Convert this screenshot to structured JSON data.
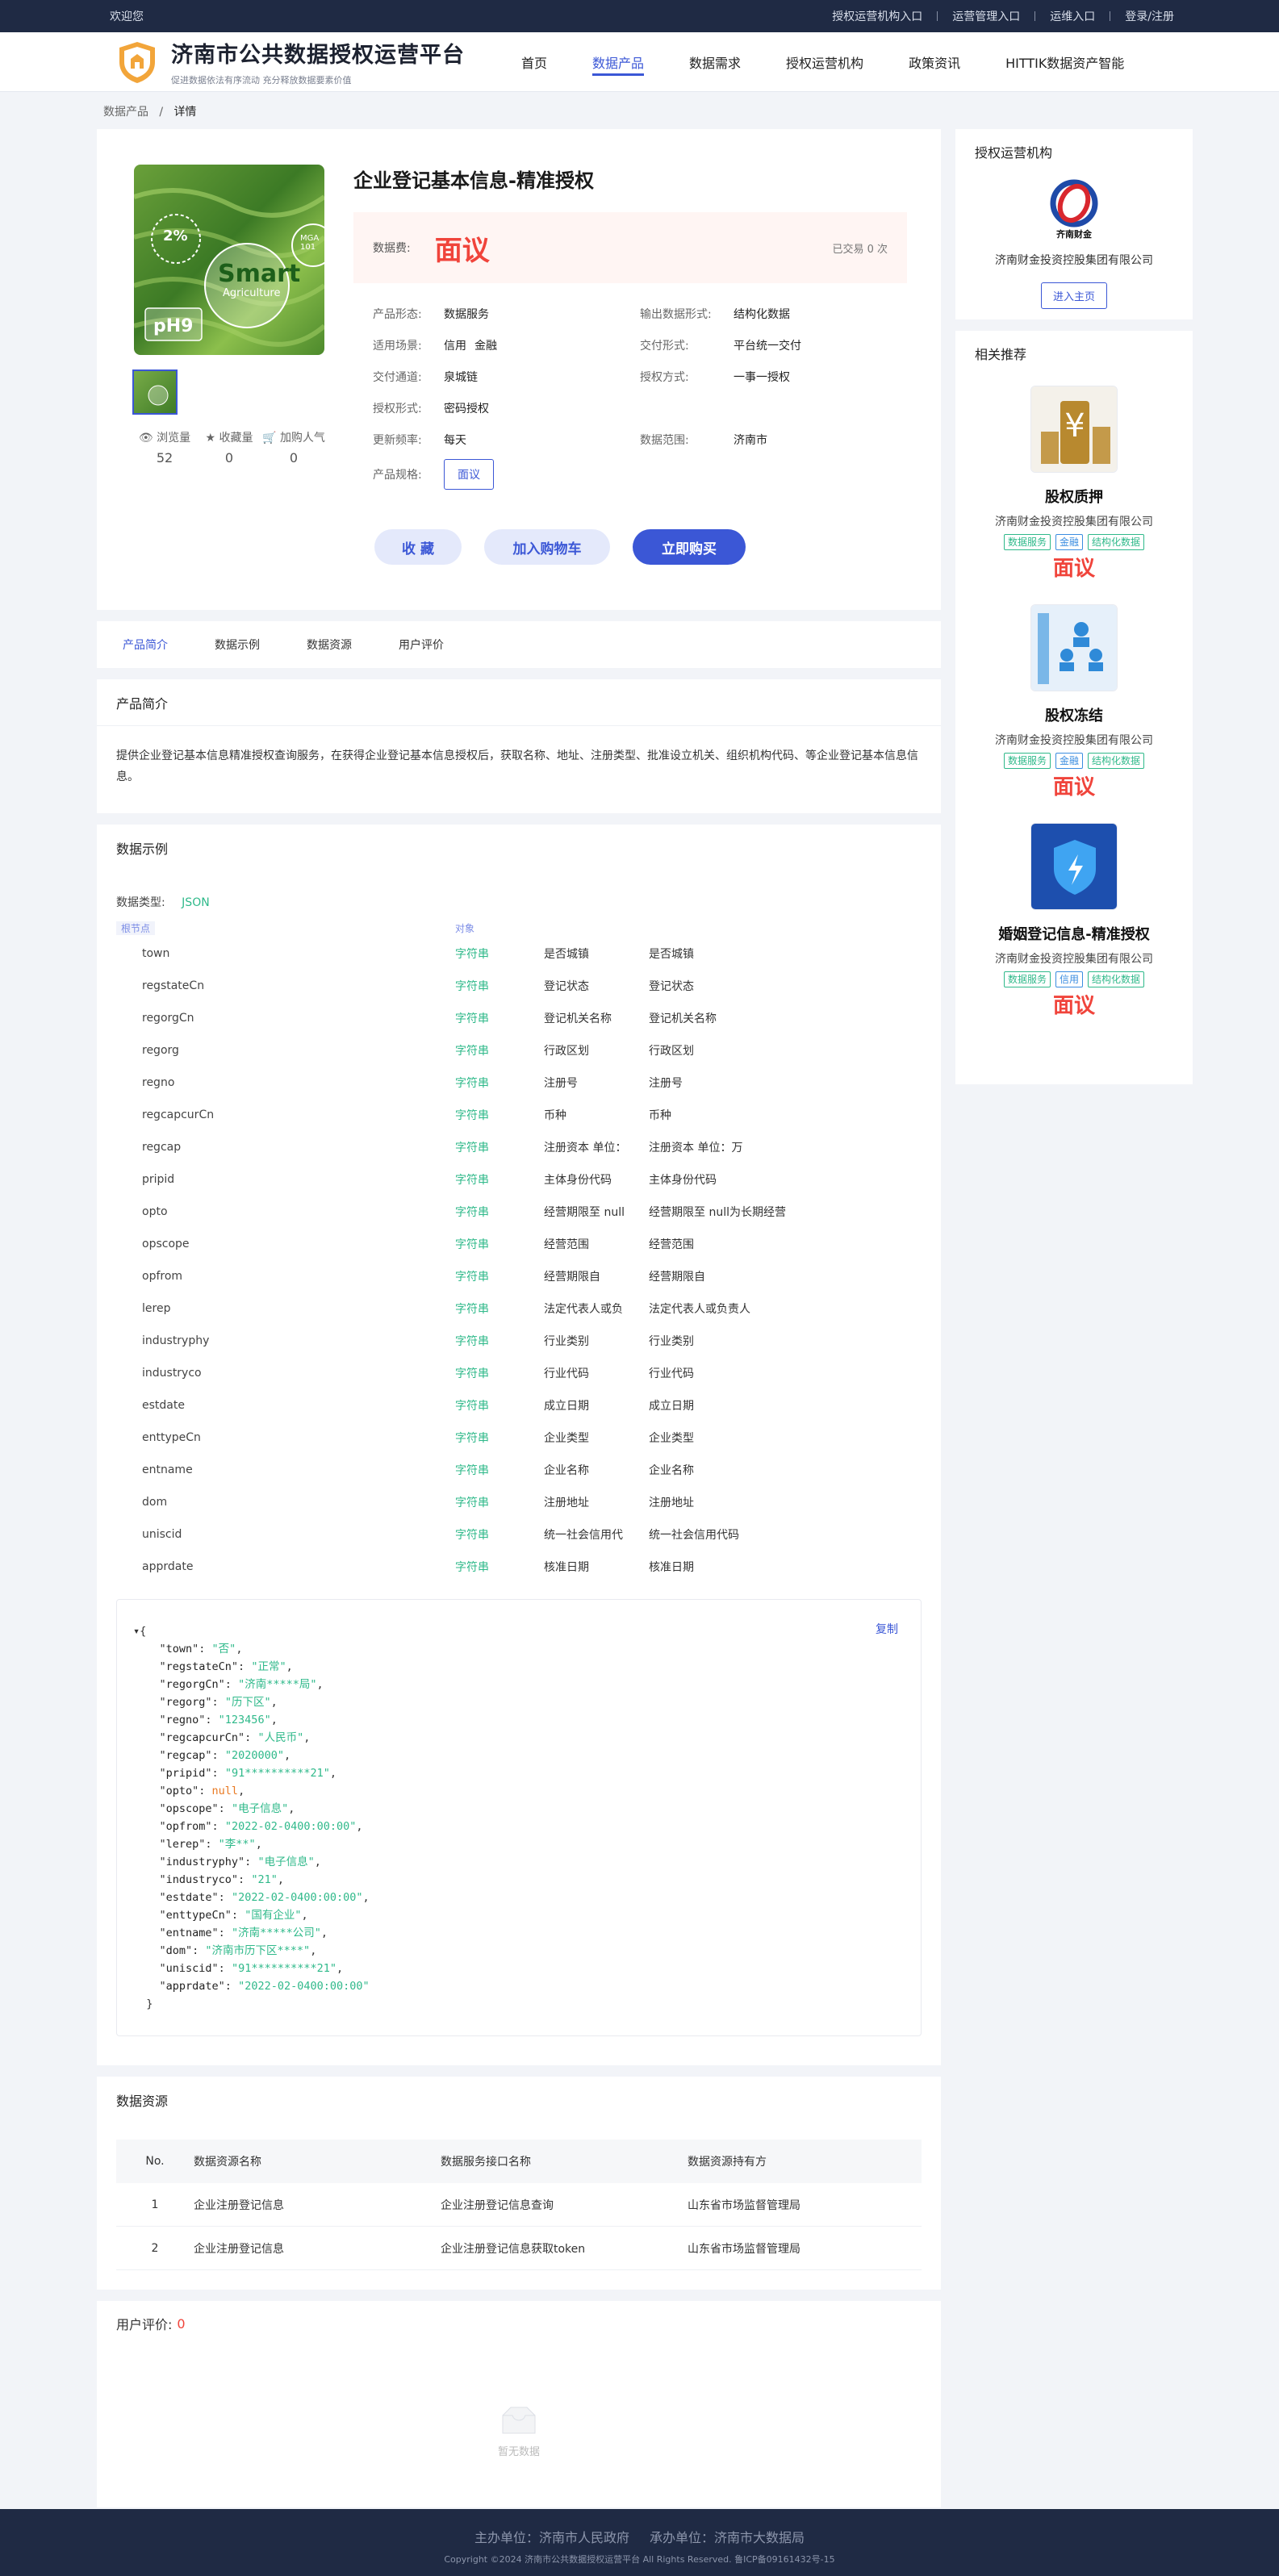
{
  "topbar": {
    "welcome": "欢迎您",
    "links": [
      "授权运营机构入口",
      "运营管理入口",
      "运维入口",
      "登录/注册"
    ]
  },
  "header": {
    "title": "济南市公共数据授权运营平台",
    "subtitle": "促进数据依法有序流动 充分释放数据要素价值",
    "nav": [
      "首页",
      "数据产品",
      "数据需求",
      "授权运营机构",
      "政策资讯",
      "HITTIK数据资产智能"
    ],
    "active_nav": "数据产品"
  },
  "breadcrumb": {
    "root": "数据产品",
    "current": "详情"
  },
  "product": {
    "title": "企业登记基本信息-精准授权",
    "price_label": "数据费:",
    "price": "面议",
    "sold": "已交易 0 次",
    "thumb_text": {
      "percent": "2%",
      "smart": "Smart",
      "agri": "Agriculture",
      "ph": "pH9",
      "mg": "MGA 101"
    },
    "stats": [
      {
        "icon": "eye-icon",
        "label": "浏览量",
        "value": "52"
      },
      {
        "icon": "star-icon",
        "label": "收藏量",
        "value": "0"
      },
      {
        "icon": "cart-icon",
        "label": "加购人气",
        "value": "0"
      }
    ],
    "attrs": [
      [
        {
          "k": "产品形态:",
          "v": [
            "数据服务"
          ]
        },
        {
          "k": "输出数据形式:",
          "v": [
            "结构化数据"
          ]
        }
      ],
      [
        {
          "k": "适用场景:",
          "v": [
            "信用",
            "金融"
          ]
        },
        {
          "k": "交付形式:",
          "v": [
            "平台统一交付"
          ]
        }
      ],
      [
        {
          "k": "交付通道:",
          "v": [
            "泉城链"
          ]
        },
        {
          "k": "授权方式:",
          "v": [
            "一事一授权"
          ]
        }
      ],
      [
        {
          "k": "授权形式:",
          "v": [
            "密码授权"
          ]
        },
        null
      ],
      [
        {
          "k": "更新频率:",
          "v": [
            "每天"
          ]
        },
        {
          "k": "数据范围:",
          "v": [
            "济南市"
          ]
        }
      ]
    ],
    "spec_label": "产品规格:",
    "spec_value": "面议",
    "buttons": {
      "fav": "收 藏",
      "cart": "加入购物车",
      "buy": "立即购买"
    }
  },
  "tabs": [
    "产品简介",
    "数据示例",
    "数据资源",
    "用户评价"
  ],
  "intro": {
    "title": "产品简介",
    "text": "提供企业登记基本信息精准授权查询服务，在获得企业登记基本信息授权后，获取名称、地址、注册类型、批准设立机关、组织机构代码、等企业登记基本信息信息。"
  },
  "example": {
    "title": "数据示例",
    "type_label": "数据类型:",
    "type_value": "JSON",
    "col_root": "根节点",
    "col_obj": "对象",
    "fields": [
      [
        "town",
        "字符串",
        "是否城镇",
        "是否城镇"
      ],
      [
        "regstateCn",
        "字符串",
        "登记状态",
        "登记状态"
      ],
      [
        "regorgCn",
        "字符串",
        "登记机关名称",
        "登记机关名称"
      ],
      [
        "regorg",
        "字符串",
        "行政区划",
        "行政区划"
      ],
      [
        "regno",
        "字符串",
        "注册号",
        "注册号"
      ],
      [
        "regcapcurCn",
        "字符串",
        "币种",
        "币种"
      ],
      [
        "regcap",
        "字符串",
        "注册资本 单位：",
        "注册资本 单位：万"
      ],
      [
        "pripid",
        "字符串",
        "主体身份代码",
        "主体身份代码"
      ],
      [
        "opto",
        "字符串",
        "经营期限至 null",
        "经营期限至 null为长期经营"
      ],
      [
        "opscope",
        "字符串",
        "经营范围",
        "经营范围"
      ],
      [
        "opfrom",
        "字符串",
        "经营期限自",
        "经营期限自"
      ],
      [
        "lerep",
        "字符串",
        "法定代表人或负",
        "法定代表人或负责人"
      ],
      [
        "industryphy",
        "字符串",
        "行业类别",
        "行业类别"
      ],
      [
        "industryco",
        "字符串",
        "行业代码",
        "行业代码"
      ],
      [
        "estdate",
        "字符串",
        "成立日期",
        "成立日期"
      ],
      [
        "enttypeCn",
        "字符串",
        "企业类型",
        "企业类型"
      ],
      [
        "entname",
        "字符串",
        "企业名称",
        "企业名称"
      ],
      [
        "dom",
        "字符串",
        "注册地址",
        "注册地址"
      ],
      [
        "uniscid",
        "字符串",
        "统一社会信用代",
        "统一社会信用代码"
      ],
      [
        "apprdate",
        "字符串",
        "核准日期",
        "核准日期"
      ]
    ],
    "copy_label": "复制",
    "json_lines": [
      [
        "town",
        "\"否\""
      ],
      [
        "regstateCn",
        "\"正常\""
      ],
      [
        "regorgCn",
        "\"济南*****局\""
      ],
      [
        "regorg",
        "\"历下区\""
      ],
      [
        "regno",
        "\"123456\""
      ],
      [
        "regcapcurCn",
        "\"人民币\""
      ],
      [
        "regcap",
        "\"2020000\""
      ],
      [
        "pripid",
        "\"91**********21\""
      ],
      [
        "opto",
        "null"
      ],
      [
        "opscope",
        "\"电子信息\""
      ],
      [
        "opfrom",
        "\"2022-02-0400:00:00\""
      ],
      [
        "lerep",
        "\"李**\""
      ],
      [
        "industryphy",
        "\"电子信息\""
      ],
      [
        "industryco",
        "\"21\""
      ],
      [
        "estdate",
        "\"2022-02-0400:00:00\""
      ],
      [
        "enttypeCn",
        "\"国有企业\""
      ],
      [
        "entname",
        "\"济南*****公司\""
      ],
      [
        "dom",
        "\"济南市历下区****\""
      ],
      [
        "uniscid",
        "\"91**********21\""
      ],
      [
        "apprdate",
        "\"2022-02-0400:00:00\""
      ]
    ]
  },
  "resources": {
    "title": "数据资源",
    "headers": [
      "No.",
      "数据资源名称",
      "数据服务接口名称",
      "数据资源持有方"
    ],
    "rows": [
      [
        "1",
        "企业注册登记信息",
        "企业注册登记信息查询",
        "山东省市场监督管理局"
      ],
      [
        "2",
        "企业注册登记信息",
        "企业注册登记信息获取token",
        "山东省市场监督管理局"
      ]
    ]
  },
  "reviews": {
    "title": "用户评价:",
    "count": "0",
    "empty": "暂无数据"
  },
  "sidebar": {
    "org_title": "授权运营机构",
    "org_logo_text": "齐南财金",
    "org_name": "济南财金投资控股集团有限公司",
    "org_btn": "进入主页",
    "rec_title": "相关推荐",
    "recs": [
      {
        "name": "股权质押",
        "org": "济南财金投资控股集团有限公司",
        "tags": [
          "数据服务",
          "金融",
          "结构化数据"
        ],
        "price": "面议",
        "img": "yuan-coins-icon"
      },
      {
        "name": "股权冻结",
        "org": "济南财金投资控股集团有限公司",
        "tags": [
          "数据服务",
          "金融",
          "结构化数据"
        ],
        "price": "面议",
        "img": "org-chart-icon"
      },
      {
        "name": "婚姻登记信息-精准授权",
        "org": "济南财金投资控股集团有限公司",
        "tags": [
          "数据服务",
          "信用",
          "结构化数据"
        ],
        "price": "面议",
        "img": "shield-umbrella-icon"
      }
    ]
  },
  "footer": {
    "host": "主办单位：济南市人民政府",
    "org": "承办单位：济南市大数据局",
    "copyright": "Copyright ©2024 济南市公共数据授权运营平台 All Rights Reserved. 鲁ICP备09161432号-15"
  },
  "colors": {
    "primary": "#3b57d6",
    "price": "#f0443b",
    "string": "#2fb98a",
    "dark": "#1f2a44"
  }
}
